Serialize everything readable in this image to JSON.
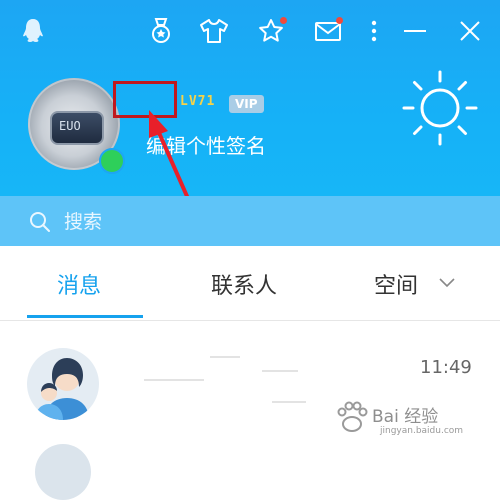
{
  "colors": {
    "header": "#1da6f3",
    "search_bar": "#5ec4f8",
    "accent": "#16a2ee",
    "online": "#2ecf5a",
    "annotation": "#c0181e"
  },
  "toolbar": {
    "icons": [
      "qq-penguin-icon",
      "medal-icon",
      "skin-shirt-icon",
      "star-icon",
      "mail-icon",
      "more-menu-icon",
      "minimize-icon",
      "close-icon"
    ]
  },
  "profile": {
    "level_badge": "LV71",
    "vip_badge": "VIP",
    "signature": "编辑个性签名",
    "avatar_text": "EUO"
  },
  "search": {
    "placeholder": "搜索"
  },
  "tabs": [
    {
      "label": "消息",
      "active": true
    },
    {
      "label": "联系人",
      "active": false
    },
    {
      "label": "空间",
      "active": false
    }
  ],
  "messages": [
    {
      "time": "11:49"
    }
  ],
  "watermark": {
    "title": "Bai 经验",
    "url": "jingyan.baidu.com"
  }
}
